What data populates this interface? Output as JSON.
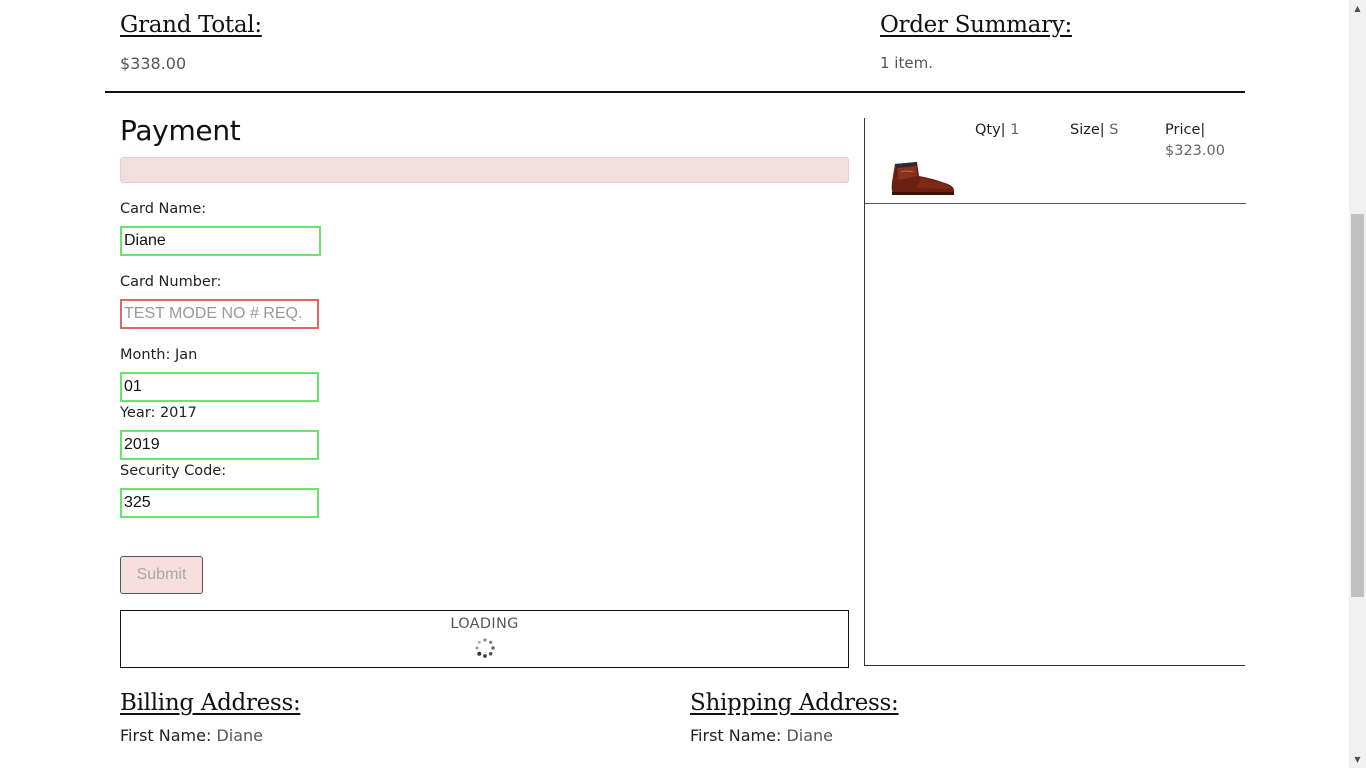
{
  "summary": {
    "grand_total_heading": "Grand Total:",
    "grand_total_value": "$338.00",
    "order_summary_heading": "Order Summary:",
    "order_summary_count": "1 item."
  },
  "payment": {
    "title": "Payment",
    "card_name_label": "Card Name:",
    "card_name_value": "Diane",
    "card_number_label": "Card Number:",
    "card_number_placeholder": "TEST MODE NO # REQ.",
    "month_label": "Month: Jan",
    "month_value": "01",
    "year_label": "Year: 2017",
    "year_value": "2019",
    "security_label": "Security Code:",
    "security_value": "325",
    "submit_label": "Submit",
    "loading_text": "LOADING"
  },
  "order_item": {
    "qty_label": "Qty|",
    "qty_value": "1",
    "size_label": "Size|",
    "size_value": "S",
    "price_label": "Price|",
    "price_value": "$323.00",
    "image_icon": "brown-leather-chukka-boot"
  },
  "billing": {
    "heading": "Billing Address:",
    "first_name_label": "First Name:",
    "first_name_value": "Diane"
  },
  "shipping": {
    "heading": "Shipping Address:",
    "first_name_label": "First Name:",
    "first_name_value": "Diane"
  },
  "colors": {
    "valid_border": "#6ee26e",
    "invalid_border": "#e06666",
    "error_bar": "#f2dede",
    "submit_bg": "#f8dede"
  }
}
